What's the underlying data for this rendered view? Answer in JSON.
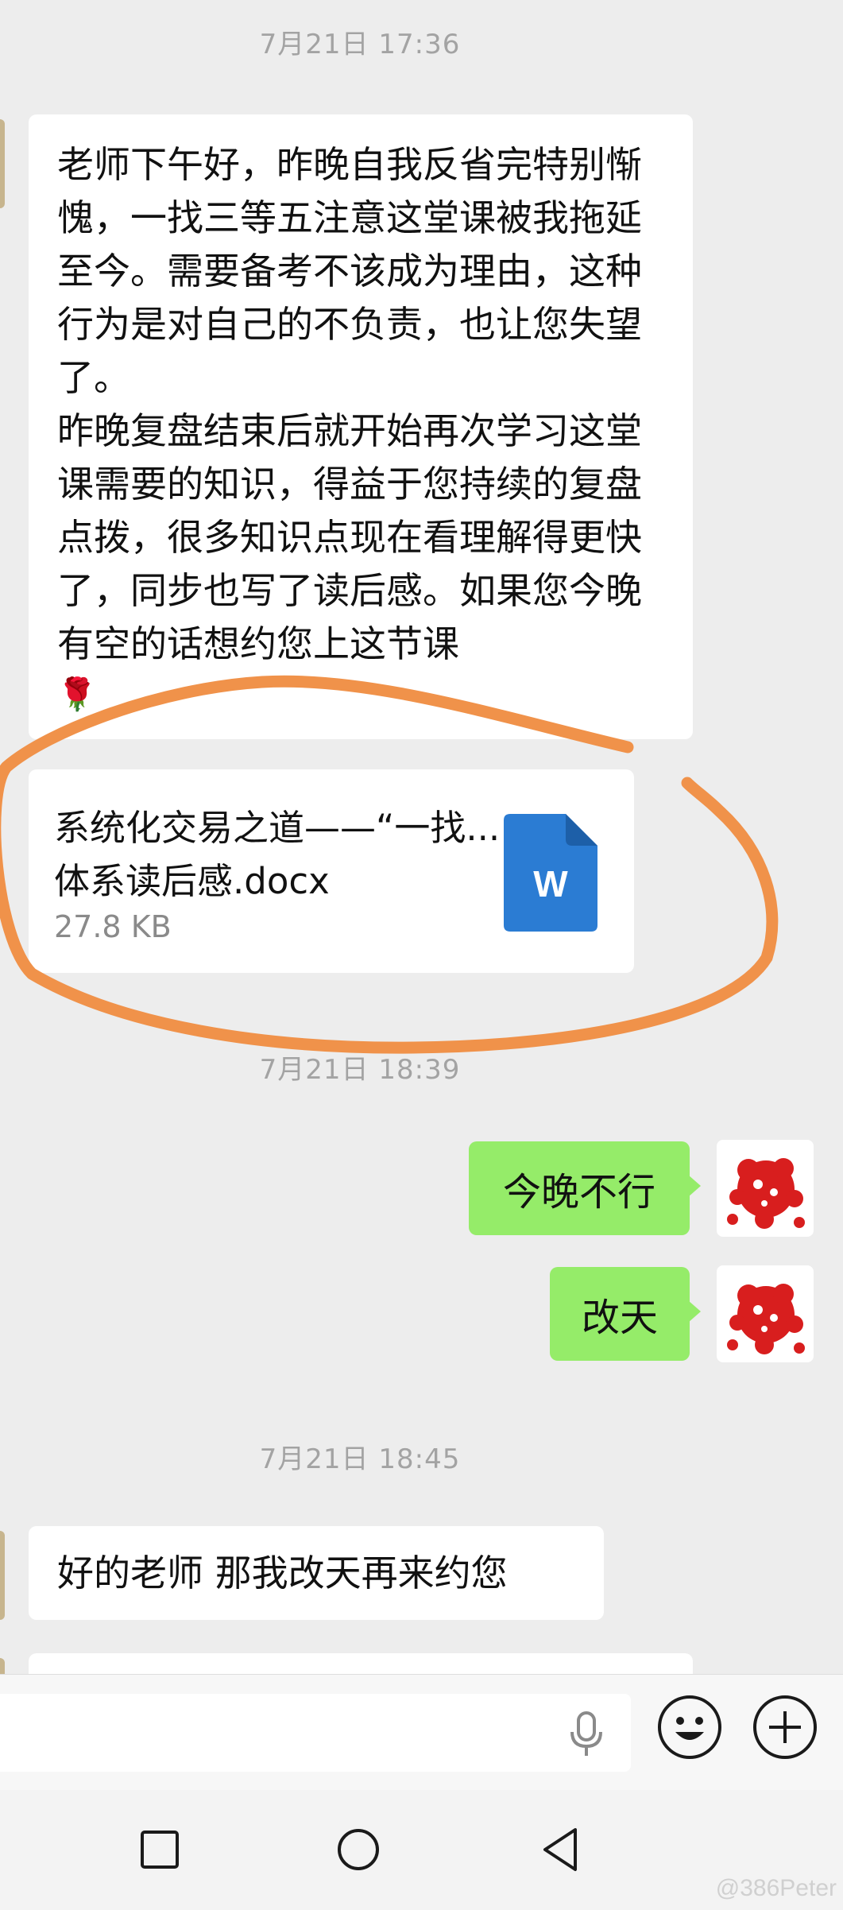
{
  "chat": {
    "timestamp_1": "7月21日 17:36",
    "timestamp_2": "7月21日 18:39",
    "timestamp_3": "7月21日 18:45",
    "msg_1_text": "老师下午好，昨晚自我反省完特别惭愧，一找三等五注意这堂课被我拖延至今。需要备考不该成为理由，这种行为是对自己的不负责，也让您失望了。\n昨晚复盘结束后就开始再次学习这堂课需要的知识，得益于您持续的复盘点拨，很多知识点现在看理解得更快了，同步也写了读后感。如果您今晚有空的话想约您上这节课",
    "msg_1_emoji": "🌹",
    "file": {
      "name": "系统化交易之道——“一找...体系读后感.docx",
      "size": "27.8 KB",
      "icon_letter": "W",
      "icon": "word-document-icon"
    },
    "sent_1": "今晚不行",
    "sent_2": "改天",
    "reply_1": "好的老师 那我改天再来约您"
  },
  "annotation": {
    "color": "#f0924a",
    "shape": "hand-drawn-ellipse"
  },
  "input_bar": {
    "voice_icon": "microphone-icon",
    "emoji_icon": "smiley-icon",
    "more_icon": "plus-icon"
  },
  "nav": {
    "recent_icon": "square-icon",
    "home_icon": "circle-icon",
    "back_icon": "triangle-back-icon"
  },
  "watermark": "@386Peter",
  "colors": {
    "sent_bubble": "#95ec69",
    "background": "#ededed",
    "word_blue": "#2b7cd3"
  }
}
